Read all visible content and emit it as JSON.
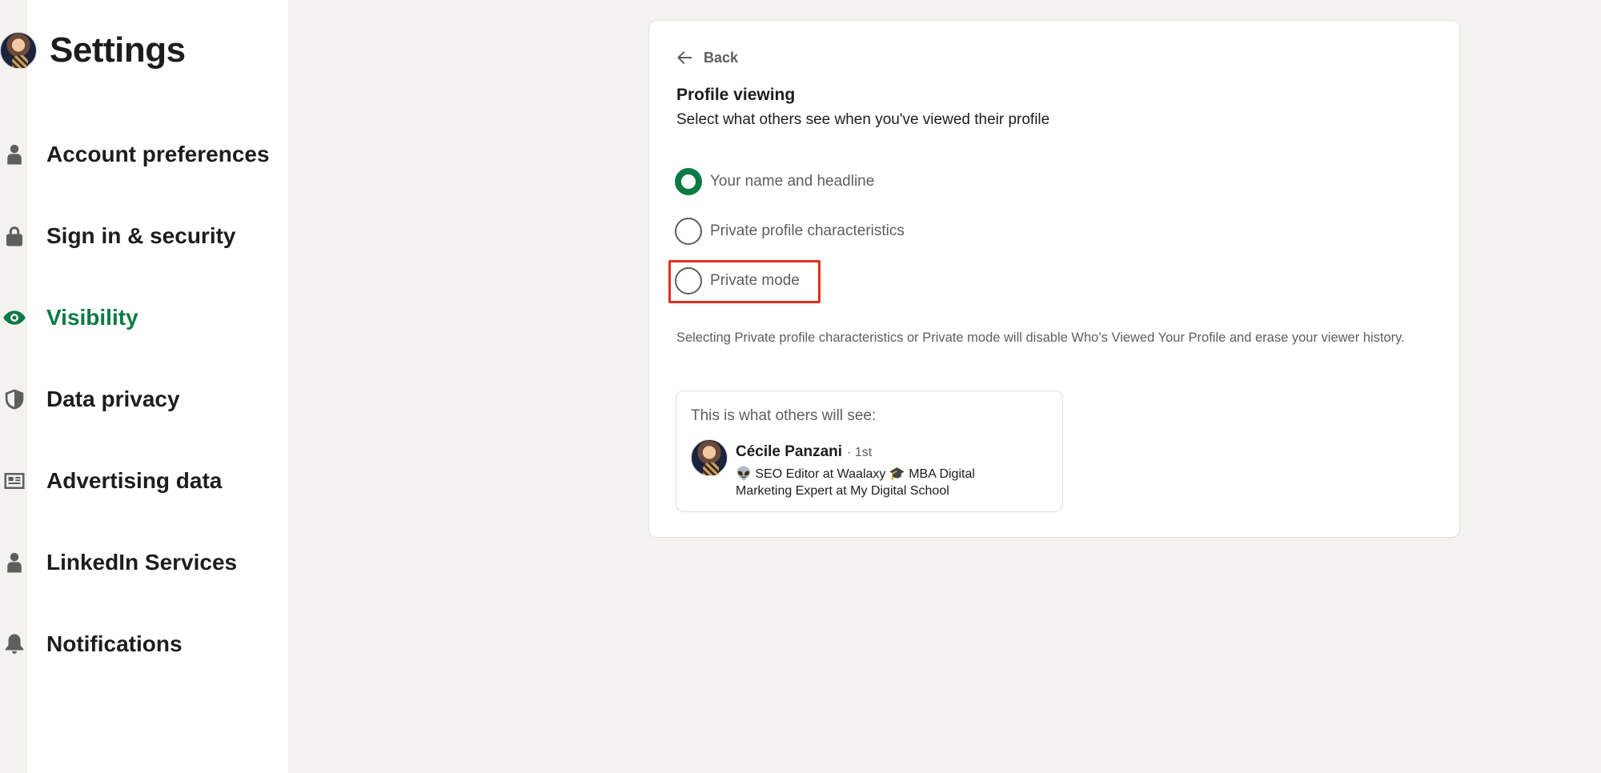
{
  "sidebar": {
    "title": "Settings",
    "items": [
      {
        "label": "Account preferences",
        "icon": "person-icon",
        "active": false
      },
      {
        "label": "Sign in & security",
        "icon": "lock-icon",
        "active": false
      },
      {
        "label": "Visibility",
        "icon": "eye-icon",
        "active": true
      },
      {
        "label": "Data privacy",
        "icon": "shield-icon",
        "active": false
      },
      {
        "label": "Advertising data",
        "icon": "newspaper-icon",
        "active": false
      },
      {
        "label": "LinkedIn Services",
        "icon": "person-icon",
        "active": false
      },
      {
        "label": "Notifications",
        "icon": "bell-icon",
        "active": false
      }
    ]
  },
  "main": {
    "back_label": "Back",
    "title": "Profile viewing",
    "subtitle": "Select what others see when you've viewed their profile",
    "options": [
      {
        "label": "Your name and headline",
        "selected": true
      },
      {
        "label": "Private profile characteristics",
        "selected": false
      },
      {
        "label": "Private mode",
        "selected": false
      }
    ],
    "disclaimer": "Selecting Private profile characteristics or Private mode will disable Who’s Viewed Your Profile and erase your viewer history.",
    "preview": {
      "heading": "This is what others will see:",
      "name": "Cécile Panzani",
      "degree": "· 1st",
      "headline": "👽 SEO Editor at Waalaxy 🎓 MBA Digital Marketing Expert at My Digital School"
    }
  },
  "colors": {
    "accent": "#0b7a44",
    "highlight": "#e0301e",
    "background": "#f3f2ef"
  }
}
